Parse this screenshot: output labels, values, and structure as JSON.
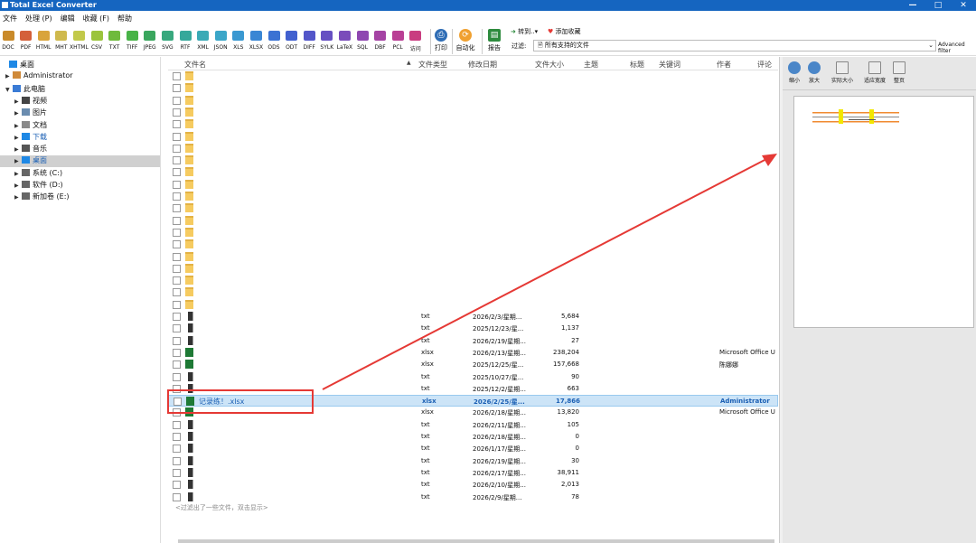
{
  "app": {
    "title": "Total Excel Converter"
  },
  "window_controls": [
    "—",
    "□",
    "✕"
  ],
  "menu": [
    "文件",
    "处理 (P)",
    "编辑",
    "收藏 (F)",
    "帮助"
  ],
  "toolbar": {
    "formats": [
      {
        "label": "DOC",
        "color": "#c98a2a"
      },
      {
        "label": "PDF",
        "color": "#d4603a"
      },
      {
        "label": "HTML",
        "color": "#d9a43b"
      },
      {
        "label": "MHT",
        "color": "#cfb94d"
      },
      {
        "label": "XHTML",
        "color": "#c2c94a"
      },
      {
        "label": "CSV",
        "color": "#9bc43d"
      },
      {
        "label": "TXT",
        "color": "#6fba3c"
      },
      {
        "label": "TIFF",
        "color": "#48b347"
      },
      {
        "label": "JPEG",
        "color": "#3aa65e"
      },
      {
        "label": "SVG",
        "color": "#38a87e"
      },
      {
        "label": "RTF",
        "color": "#36a89b"
      },
      {
        "label": "XML",
        "color": "#3aaab6"
      },
      {
        "label": "JSON",
        "color": "#3ba6c8"
      },
      {
        "label": "XLS",
        "color": "#3a98d1"
      },
      {
        "label": "XLSX",
        "color": "#3a86d4"
      },
      {
        "label": "ODS",
        "color": "#3b72d3"
      },
      {
        "label": "ODT",
        "color": "#4160cf"
      },
      {
        "label": "DIFF",
        "color": "#5356c9"
      },
      {
        "label": "SYLK",
        "color": "#6650c2"
      },
      {
        "label": "LaTeX",
        "color": "#7a4cba"
      },
      {
        "label": "SQL",
        "color": "#8e47b1"
      },
      {
        "label": "DBF",
        "color": "#a543a4"
      },
      {
        "label": "PCL",
        "color": "#b93f94"
      },
      {
        "label": "访问",
        "color": "#c93d80"
      }
    ],
    "print_label": "打印",
    "automate_label": "自动化",
    "report_label": "报告",
    "goto_label": "转到..",
    "fav_label": "添加收藏",
    "filter_label": "过滤:",
    "filter_value": "所有支持的文件",
    "advanced_filter": "Advanced filter"
  },
  "sidebar": {
    "items": [
      {
        "label": "桌面",
        "icon": "desktop-icon",
        "level": 0,
        "arrow": ""
      },
      {
        "label": "Administrator",
        "icon": "user-icon",
        "level": 1,
        "arrow": "▶"
      },
      {
        "label": "此电脑",
        "icon": "pc-icon",
        "level": 1,
        "arrow": "▼"
      },
      {
        "label": "视频",
        "icon": "video-icon",
        "level": 2,
        "arrow": "▶"
      },
      {
        "label": "图片",
        "icon": "pictures-icon",
        "level": 2,
        "arrow": "▶"
      },
      {
        "label": "文档",
        "icon": "documents-icon",
        "level": 2,
        "arrow": "▶"
      },
      {
        "label": "下载",
        "icon": "download-icon",
        "level": 2,
        "arrow": "▶"
      },
      {
        "label": "音乐",
        "icon": "music-icon",
        "level": 2,
        "arrow": "▶"
      },
      {
        "label": "桌面",
        "icon": "desktop-icon",
        "level": 2,
        "arrow": "▶",
        "selected": true
      },
      {
        "label": "系统 (C:)",
        "icon": "drive-icon",
        "level": 2,
        "arrow": "▶"
      },
      {
        "label": "软件 (D:)",
        "icon": "drive-icon",
        "level": 2,
        "arrow": "▶"
      },
      {
        "label": "新加卷 (E:)",
        "icon": "drive-icon",
        "level": 2,
        "arrow": "▶"
      }
    ]
  },
  "columns": [
    "文件名",
    "文件类型",
    "修改日期",
    "文件大小",
    "主题",
    "标题",
    "关键词",
    "作者",
    "评论"
  ],
  "folder_count": 20,
  "files": [
    {
      "name": "",
      "type": "txt",
      "date": "2026/2/3/星期...",
      "size": "5,684",
      "author": "",
      "kind": "txt"
    },
    {
      "name": "",
      "type": "txt",
      "date": "2025/12/23/星...",
      "size": "1,137",
      "author": "",
      "kind": "txt"
    },
    {
      "name": "",
      "type": "txt",
      "date": "2026/2/19/星期...",
      "size": "27",
      "author": "",
      "kind": "txt"
    },
    {
      "name": "",
      "type": "xlsx",
      "date": "2026/2/13/星期...",
      "size": "238,204",
      "author": "Microsoft Office U",
      "kind": "xlsx"
    },
    {
      "name": "",
      "type": "xlsx",
      "date": "2025/12/25/星...",
      "size": "157,668",
      "author": "陈娜娜",
      "kind": "xlsx"
    },
    {
      "name": "",
      "type": "txt",
      "date": "2025/10/27/星...",
      "size": "90",
      "author": "",
      "kind": "txt"
    },
    {
      "name": "",
      "type": "txt",
      "date": "2025/12/2/星期...",
      "size": "663",
      "author": "",
      "kind": "txt"
    },
    {
      "name": "记录练！.xlsx",
      "type": "xlsx",
      "date": "2026/2/25/星...",
      "size": "17,866",
      "author": "Administrator",
      "kind": "xlsx",
      "selected": true
    },
    {
      "name": "",
      "type": "xlsx",
      "date": "2026/2/18/星期...",
      "size": "13,820",
      "author": "Microsoft Office U",
      "kind": "xlsx"
    },
    {
      "name": "",
      "type": "txt",
      "date": "2026/2/11/星期...",
      "size": "105",
      "author": "",
      "kind": "txt"
    },
    {
      "name": "",
      "type": "txt",
      "date": "2026/2/18/星期...",
      "size": "0",
      "author": "",
      "kind": "txt"
    },
    {
      "name": "",
      "type": "txt",
      "date": "2026/1/17/星期...",
      "size": "0",
      "author": "",
      "kind": "txt"
    },
    {
      "name": "",
      "type": "txt",
      "date": "2026/2/19/星期...",
      "size": "30",
      "author": "",
      "kind": "txt"
    },
    {
      "name": "",
      "type": "txt",
      "date": "2026/2/17/星期...",
      "size": "38,911",
      "author": "",
      "kind": "txt"
    },
    {
      "name": "",
      "type": "txt",
      "date": "2026/2/10/星期...",
      "size": "2,013",
      "author": "",
      "kind": "txt"
    },
    {
      "name": "",
      "type": "txt",
      "date": "2026/2/9/星期...",
      "size": "78",
      "author": "",
      "kind": "txt"
    }
  ],
  "filtered_message": "<过滤出了一些文件，双击显示>",
  "preview": {
    "tools": [
      {
        "label": "缩小",
        "icon": "zoom-out-icon"
      },
      {
        "label": "放大",
        "icon": "zoom-in-icon"
      },
      {
        "label": "实际大小",
        "icon": "actual-size-icon"
      },
      {
        "label": "适应宽度",
        "icon": "fit-width-icon"
      },
      {
        "label": "整页",
        "icon": "full-page-icon"
      }
    ]
  },
  "annotation": {
    "color": "#e53935"
  }
}
